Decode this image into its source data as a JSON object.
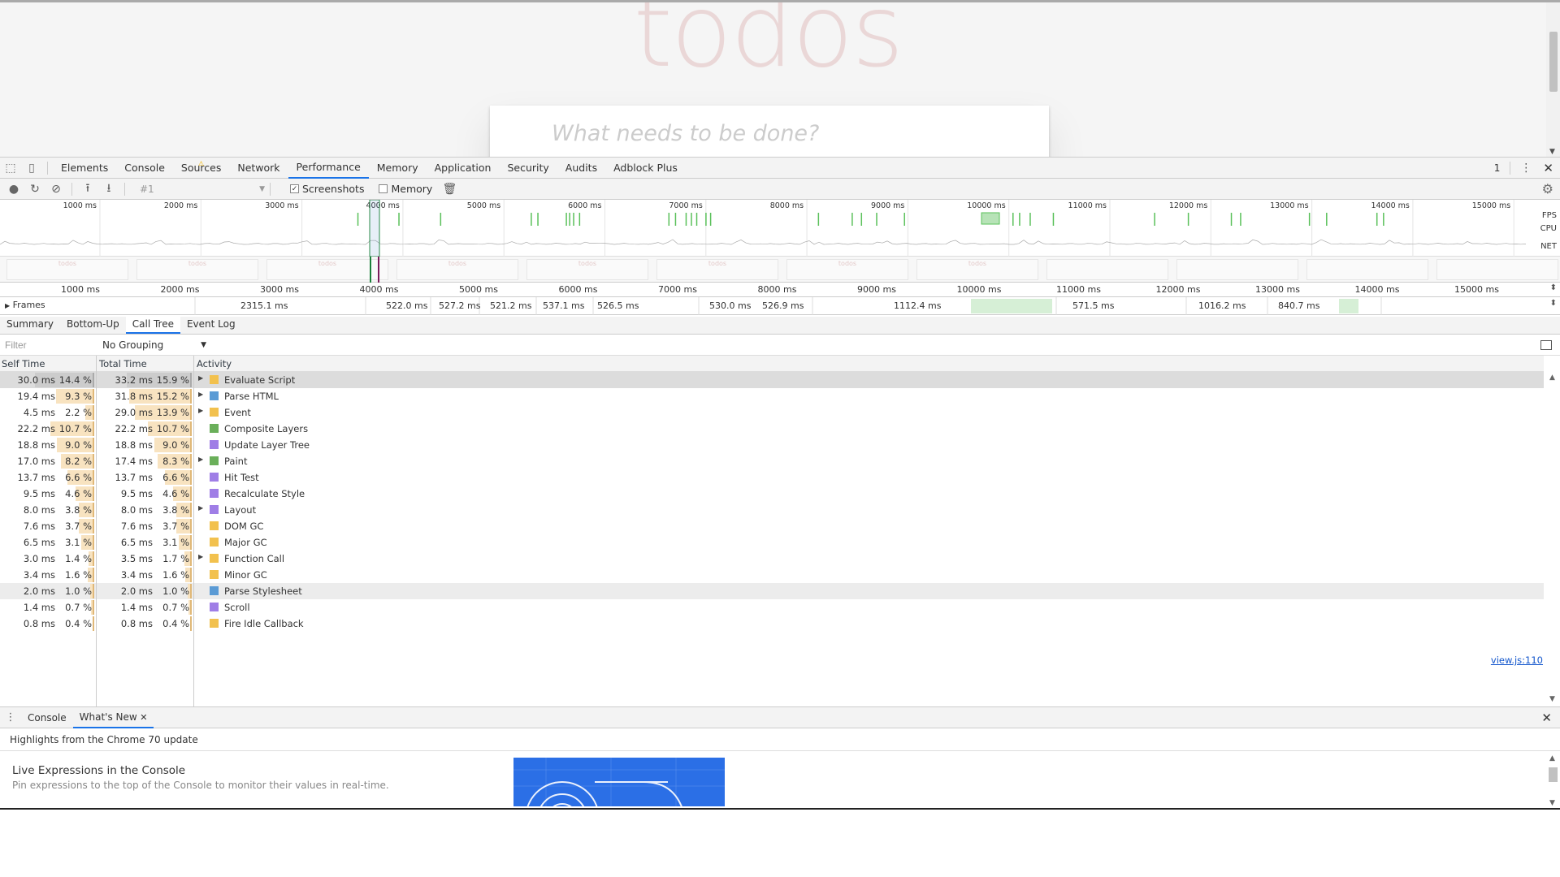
{
  "page": {
    "title": "todos",
    "input_placeholder": "What needs to be done?"
  },
  "devtools": {
    "tabs": [
      "Elements",
      "Console",
      "Sources",
      "Network",
      "Performance",
      "Memory",
      "Application",
      "Security",
      "Audits",
      "Adblock Plus"
    ],
    "active_tab": "Performance",
    "warning_count": "1",
    "toolbar": {
      "profile_select": "#1",
      "screenshots_label": "Screenshots",
      "screenshots_checked": true,
      "memory_label": "Memory",
      "memory_checked": false
    },
    "overview": {
      "ticks": [
        "1000 ms",
        "2000 ms",
        "3000 ms",
        "4000 ms",
        "5000 ms",
        "6000 ms",
        "7000 ms",
        "8000 ms",
        "9000 ms",
        "10000 ms",
        "11000 ms",
        "12000 ms",
        "13000 ms",
        "14000 ms",
        "15000 ms"
      ],
      "side_labels": [
        "FPS",
        "CPU",
        "NET"
      ],
      "screenshot_label": "todos"
    },
    "axis_ticks": [
      "1000 ms",
      "2000 ms",
      "3000 ms",
      "4000 ms",
      "5000 ms",
      "6000 ms",
      "7000 ms",
      "8000 ms",
      "9000 ms",
      "10000 ms",
      "11000 ms",
      "12000 ms",
      "13000 ms",
      "14000 ms",
      "15000 ms"
    ],
    "frames": {
      "label": "Frames",
      "durations": [
        "2315.1 ms",
        "522.0 ms",
        "527.2 ms",
        "521.2 ms",
        "537.1 ms",
        "526.5 ms",
        "530.0 ms",
        "526.9 ms",
        "1112.4 ms",
        "571.5 ms",
        "1016.2 ms",
        "840.7 ms"
      ]
    },
    "subtabs": [
      "Summary",
      "Bottom-Up",
      "Call Tree",
      "Event Log"
    ],
    "active_subtab": "Call Tree",
    "filter_placeholder": "Filter",
    "grouping": "No Grouping",
    "columns": {
      "self": "Self Time",
      "total": "Total Time",
      "activity": "Activity"
    },
    "rows": [
      {
        "self_ms": "30.0 ms",
        "self_pct": "14.4 %",
        "total_ms": "33.2 ms",
        "total_pct": "15.9 %",
        "activity": "Evaluate Script",
        "color": "#f2c14e",
        "expandable": true,
        "self_frac": 0.144,
        "total_frac": 0.159
      },
      {
        "self_ms": "19.4 ms",
        "self_pct": "9.3 %",
        "total_ms": "31.8 ms",
        "total_pct": "15.2 %",
        "activity": "Parse HTML",
        "color": "#5b9bd5",
        "expandable": true,
        "self_frac": 0.093,
        "total_frac": 0.152
      },
      {
        "self_ms": "4.5 ms",
        "self_pct": "2.2 %",
        "total_ms": "29.0 ms",
        "total_pct": "13.9 %",
        "activity": "Event",
        "color": "#f2c14e",
        "expandable": true,
        "self_frac": 0.022,
        "total_frac": 0.139
      },
      {
        "self_ms": "22.2 ms",
        "self_pct": "10.7 %",
        "total_ms": "22.2 ms",
        "total_pct": "10.7 %",
        "activity": "Composite Layers",
        "color": "#6aaf5a",
        "expandable": false,
        "self_frac": 0.107,
        "total_frac": 0.107
      },
      {
        "self_ms": "18.8 ms",
        "self_pct": "9.0 %",
        "total_ms": "18.8 ms",
        "total_pct": "9.0 %",
        "activity": "Update Layer Tree",
        "color": "#9f7ee6",
        "expandable": false,
        "self_frac": 0.09,
        "total_frac": 0.09
      },
      {
        "self_ms": "17.0 ms",
        "self_pct": "8.2 %",
        "total_ms": "17.4 ms",
        "total_pct": "8.3 %",
        "activity": "Paint",
        "color": "#6aaf5a",
        "expandable": true,
        "self_frac": 0.082,
        "total_frac": 0.083
      },
      {
        "self_ms": "13.7 ms",
        "self_pct": "6.6 %",
        "total_ms": "13.7 ms",
        "total_pct": "6.6 %",
        "activity": "Hit Test",
        "color": "#9f7ee6",
        "expandable": false,
        "self_frac": 0.066,
        "total_frac": 0.066
      },
      {
        "self_ms": "9.5 ms",
        "self_pct": "4.6 %",
        "total_ms": "9.5 ms",
        "total_pct": "4.6 %",
        "activity": "Recalculate Style",
        "color": "#9f7ee6",
        "expandable": false,
        "self_frac": 0.046,
        "total_frac": 0.046
      },
      {
        "self_ms": "8.0 ms",
        "self_pct": "3.8 %",
        "total_ms": "8.0 ms",
        "total_pct": "3.8 %",
        "activity": "Layout",
        "color": "#9f7ee6",
        "expandable": true,
        "self_frac": 0.038,
        "total_frac": 0.038
      },
      {
        "self_ms": "7.6 ms",
        "self_pct": "3.7 %",
        "total_ms": "7.6 ms",
        "total_pct": "3.7 %",
        "activity": "DOM GC",
        "color": "#f2c14e",
        "expandable": false,
        "self_frac": 0.037,
        "total_frac": 0.037
      },
      {
        "self_ms": "6.5 ms",
        "self_pct": "3.1 %",
        "total_ms": "6.5 ms",
        "total_pct": "3.1 %",
        "activity": "Major GC",
        "color": "#f2c14e",
        "expandable": false,
        "self_frac": 0.031,
        "total_frac": 0.031
      },
      {
        "self_ms": "3.0 ms",
        "self_pct": "1.4 %",
        "total_ms": "3.5 ms",
        "total_pct": "1.7 %",
        "activity": "Function Call",
        "color": "#f2c14e",
        "expandable": true,
        "self_frac": 0.014,
        "total_frac": 0.017
      },
      {
        "self_ms": "3.4 ms",
        "self_pct": "1.6 %",
        "total_ms": "3.4 ms",
        "total_pct": "1.6 %",
        "activity": "Minor GC",
        "color": "#f2c14e",
        "expandable": false,
        "self_frac": 0.016,
        "total_frac": 0.016
      },
      {
        "self_ms": "2.0 ms",
        "self_pct": "1.0 %",
        "total_ms": "2.0 ms",
        "total_pct": "1.0 %",
        "activity": "Parse Stylesheet",
        "color": "#5b9bd5",
        "expandable": false,
        "self_frac": 0.01,
        "total_frac": 0.01
      },
      {
        "self_ms": "1.4 ms",
        "self_pct": "0.7 %",
        "total_ms": "1.4 ms",
        "total_pct": "0.7 %",
        "activity": "Scroll",
        "color": "#9f7ee6",
        "expandable": false,
        "self_frac": 0.007,
        "total_frac": 0.007
      },
      {
        "self_ms": "0.8 ms",
        "self_pct": "0.4 %",
        "total_ms": "0.8 ms",
        "total_pct": "0.4 %",
        "activity": "Fire Idle Callback",
        "color": "#f2c14e",
        "expandable": false,
        "self_frac": 0.004,
        "total_frac": 0.004
      }
    ],
    "source_link": "view.js:110",
    "drawer": {
      "tabs": [
        "Console",
        "What's New"
      ],
      "active_tab": "What's New",
      "highlights": "Highlights from the Chrome 70 update",
      "feature_title": "Live Expressions in the Console",
      "feature_desc": "Pin expressions to the top of the Console to monitor their values in real-time."
    }
  }
}
